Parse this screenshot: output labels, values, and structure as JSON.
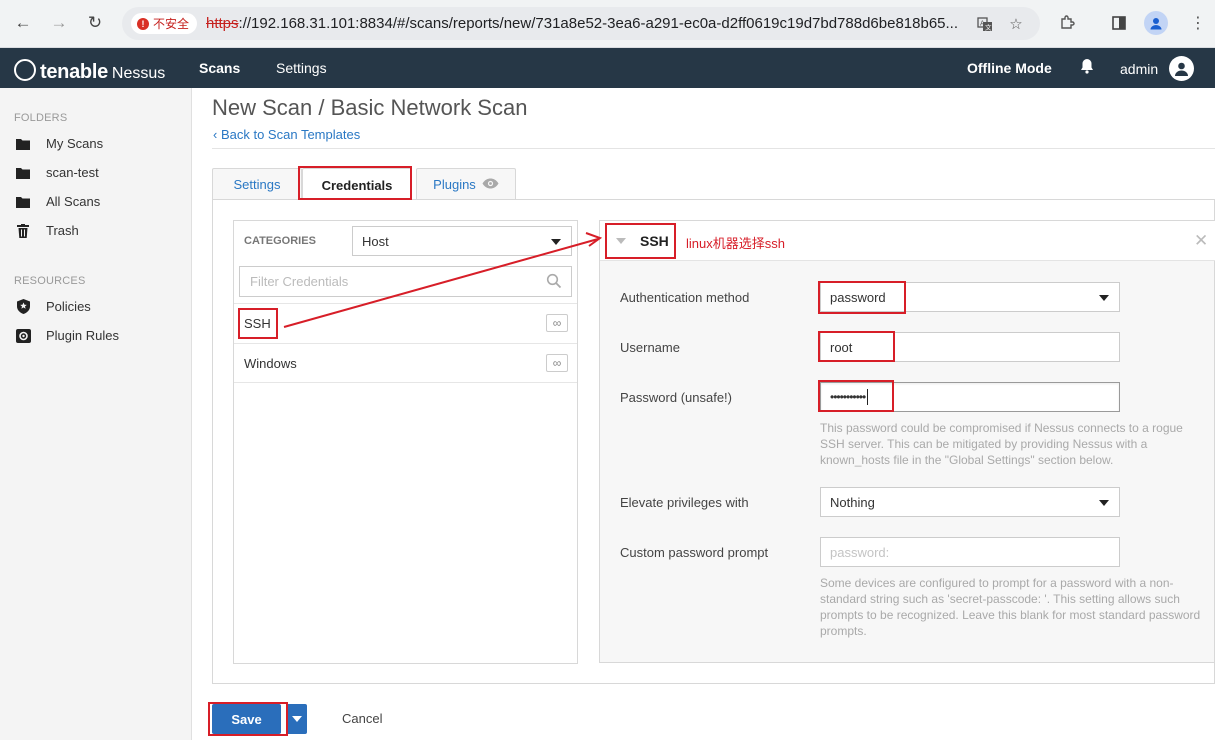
{
  "browser": {
    "insecure_label": "不安全",
    "url_scheme": "https",
    "url_rest": "://192.168.31.101:8834/#/scans/reports/new/731a8e52-3ea6-a291-ec0a-d2ff0619c19d7bd788d6be818b65..."
  },
  "header": {
    "brand": "tenable",
    "product": "Nessus",
    "nav": [
      "Scans",
      "Settings"
    ],
    "offline_mode": "Offline Mode",
    "user": "admin"
  },
  "sidebar": {
    "folders_heading": "FOLDERS",
    "folders": [
      "My Scans",
      "scan-test",
      "All Scans",
      "Trash"
    ],
    "resources_heading": "RESOURCES",
    "resources": [
      "Policies",
      "Plugin Rules"
    ]
  },
  "page": {
    "title": "New Scan / Basic Network Scan",
    "back_link": "Back to Scan Templates"
  },
  "tabs": [
    "Settings",
    "Credentials",
    "Plugins"
  ],
  "categories": {
    "label": "CATEGORIES",
    "selected": "Host",
    "filter_placeholder": "Filter Credentials",
    "items": [
      "SSH",
      "Windows"
    ],
    "badge": "∞"
  },
  "ssh": {
    "title": "SSH",
    "annotation": "linux机器选择ssh",
    "auth_label": "Authentication method",
    "auth_value": "password",
    "username_label": "Username",
    "username_value": "root",
    "password_label": "Password (unsafe!)",
    "password_value": "•••••••••••",
    "password_help": "This password could be compromised if Nessus connects to a rogue SSH server. This can be mitigated by providing Nessus with a known_hosts file in the \"Global Settings\" section below.",
    "elevate_label": "Elevate privileges with",
    "elevate_value": "Nothing",
    "prompt_label": "Custom password prompt",
    "prompt_placeholder": "password:",
    "prompt_help": "Some devices are configured to prompt for a password with a non-standard string such as 'secret-passcode: '. This setting allows such prompts to be recognized. Leave this blank for most standard password prompts."
  },
  "footer": {
    "save": "Save",
    "cancel": "Cancel"
  },
  "colors": {
    "appbar": "#263746",
    "accent": "#2a6ebb",
    "link": "#2a78c4",
    "annotation_red": "#d71e28"
  }
}
